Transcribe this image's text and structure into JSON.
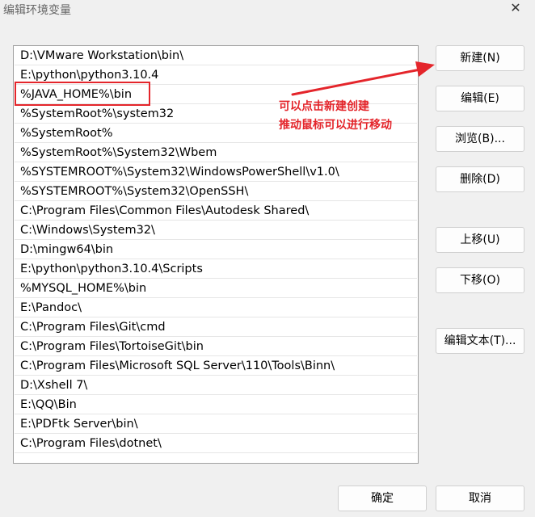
{
  "window": {
    "title": "编辑环境变量",
    "close_glyph": "✕"
  },
  "paths": [
    "D:\\VMware Workstation\\bin\\",
    "E:\\python\\python3.10.4",
    "%JAVA_HOME%\\bin",
    "%SystemRoot%\\system32",
    "%SystemRoot%",
    "%SystemRoot%\\System32\\Wbem",
    "%SYSTEMROOT%\\System32\\WindowsPowerShell\\v1.0\\",
    "%SYSTEMROOT%\\System32\\OpenSSH\\",
    "C:\\Program Files\\Common Files\\Autodesk Shared\\",
    "C:\\Windows\\System32\\",
    "D:\\mingw64\\bin",
    "E:\\python\\python3.10.4\\Scripts",
    "%MYSQL_HOME%\\bin",
    "E:\\Pandoc\\",
    "C:\\Program Files\\Git\\cmd",
    "C:\\Program Files\\TortoiseGit\\bin",
    "C:\\Program Files\\Microsoft SQL Server\\110\\Tools\\Binn\\",
    "D:\\Xshell 7\\",
    "E:\\QQ\\Bin",
    "E:\\PDFtk Server\\bin\\",
    "C:\\Program Files\\dotnet\\"
  ],
  "buttons": {
    "new": "新建(N)",
    "edit": "编辑(E)",
    "browse": "浏览(B)...",
    "delete": "删除(D)",
    "move_up": "上移(U)",
    "move_down": "下移(O)",
    "edit_text": "编辑文本(T)...",
    "ok": "确定",
    "cancel": "取消"
  },
  "annotation": {
    "line1": "可以点击新建创建",
    "line2": "推动鼠标可以进行移动",
    "color": "#e4252b"
  }
}
